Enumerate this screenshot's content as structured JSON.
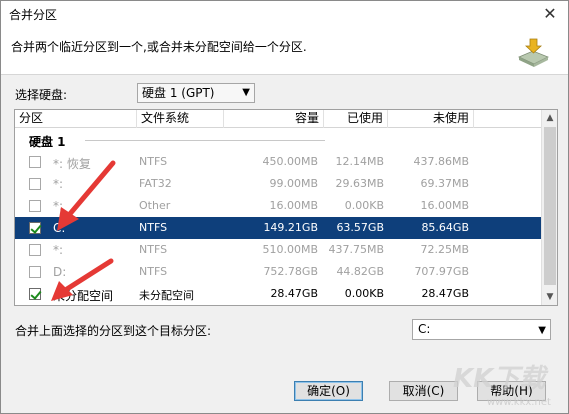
{
  "window": {
    "title": "合并分区",
    "close_glyph": "✕"
  },
  "header": {
    "description": "合并两个临近分区到一个,或合并未分配空间给一个分区."
  },
  "disk_selector": {
    "label": "选择硬盘:",
    "value": "硬盘 1 (GPT)"
  },
  "table": {
    "columns": [
      "分区",
      "文件系统",
      "容量",
      "已使用",
      "未使用"
    ],
    "group_title": "硬盘 1",
    "rows": [
      {
        "name": "*: 恢复",
        "fs": "NTFS",
        "capacity": "450.00MB",
        "used": "12.14MB",
        "free": "437.86MB",
        "checked": false
      },
      {
        "name": "*:",
        "fs": "FAT32",
        "capacity": "99.00MB",
        "used": "29.63MB",
        "free": "69.37MB",
        "checked": false
      },
      {
        "name": "*:",
        "fs": "Other",
        "capacity": "16.00MB",
        "used": "0.00KB",
        "free": "16.00MB",
        "checked": false
      },
      {
        "name": "C:",
        "fs": "NTFS",
        "capacity": "149.21GB",
        "used": "63.57GB",
        "free": "85.64GB",
        "checked": true
      },
      {
        "name": "*:",
        "fs": "NTFS",
        "capacity": "510.00MB",
        "used": "437.75MB",
        "free": "72.25MB",
        "checked": false
      },
      {
        "name": "D:",
        "fs": "NTFS",
        "capacity": "752.78GB",
        "used": "44.82GB",
        "free": "707.97GB",
        "checked": false
      },
      {
        "name": "未分配空间",
        "fs": "未分配空间",
        "capacity": "28.47GB",
        "used": "0.00KB",
        "free": "28.47GB",
        "checked": true
      }
    ]
  },
  "target": {
    "label": "合并上面选择的分区到这个目标分区:",
    "value": "C:"
  },
  "buttons": {
    "ok": "确定(O)",
    "cancel": "取消(C)",
    "help": "帮助(H)"
  },
  "watermark": {
    "brand": "KK下载",
    "url": "www.kkx.net"
  },
  "colors": {
    "selection": "#0e3f7b",
    "annotation_arrow": "#e53935",
    "check": "#1c8a1c"
  }
}
